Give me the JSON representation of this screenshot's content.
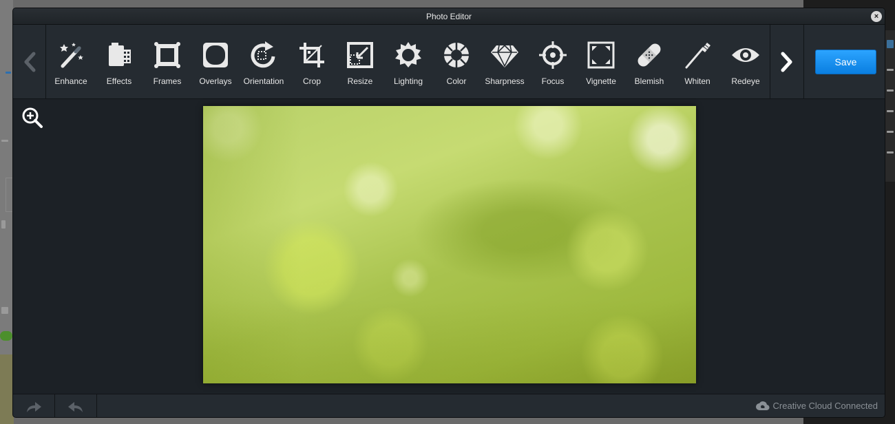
{
  "window": {
    "title": "Photo Editor",
    "close_glyph": "×"
  },
  "toolbar": {
    "tools": [
      {
        "label": "Enhance",
        "icon": "magic-wand-icon"
      },
      {
        "label": "Effects",
        "icon": "film-strip-icon"
      },
      {
        "label": "Frames",
        "icon": "frame-icon"
      },
      {
        "label": "Overlays",
        "icon": "overlay-icon"
      },
      {
        "label": "Orientation",
        "icon": "rotate-icon"
      },
      {
        "label": "Crop",
        "icon": "crop-icon"
      },
      {
        "label": "Resize",
        "icon": "resize-icon"
      },
      {
        "label": "Lighting",
        "icon": "sun-icon"
      },
      {
        "label": "Color",
        "icon": "color-wheel-icon"
      },
      {
        "label": "Sharpness",
        "icon": "diamond-icon"
      },
      {
        "label": "Focus",
        "icon": "target-icon"
      },
      {
        "label": "Vignette",
        "icon": "vignette-icon"
      },
      {
        "label": "Blemish",
        "icon": "bandage-icon"
      },
      {
        "label": "Whiten",
        "icon": "toothbrush-icon"
      },
      {
        "label": "Redeye",
        "icon": "eye-icon"
      }
    ],
    "save_label": "Save"
  },
  "footer": {
    "status": "Creative Cloud Connected"
  },
  "colors": {
    "accent": "#1a90f0",
    "panel": "#252b31",
    "background": "#1c2126",
    "text": "#e6e6e6"
  }
}
